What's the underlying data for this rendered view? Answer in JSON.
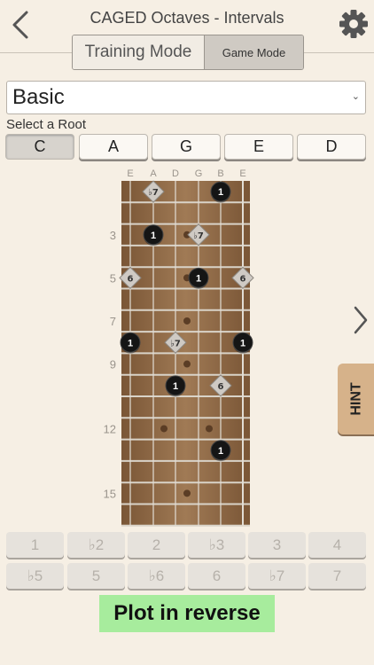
{
  "header": {
    "title": "CAGED Octaves - Intervals"
  },
  "mode_tabs": [
    {
      "label": "Training Mode",
      "selected": true
    },
    {
      "label": "Game Mode",
      "selected": false
    }
  ],
  "dropdown": {
    "value": "Basic"
  },
  "root_label": "Select a Root",
  "roots": [
    {
      "label": "C",
      "selected": true
    },
    {
      "label": "A",
      "selected": false
    },
    {
      "label": "G",
      "selected": false
    },
    {
      "label": "E",
      "selected": false
    },
    {
      "label": "D",
      "selected": false
    }
  ],
  "fretboard": {
    "strings": [
      "E",
      "A",
      "D",
      "G",
      "B",
      "E"
    ],
    "fret_labels": [
      {
        "fret": 3,
        "label": "3"
      },
      {
        "fret": 5,
        "label": "5"
      },
      {
        "fret": 7,
        "label": "7"
      },
      {
        "fret": 9,
        "label": "9"
      },
      {
        "fret": 12,
        "label": "12"
      },
      {
        "fret": 15,
        "label": "15"
      }
    ],
    "markers": [
      {
        "string": 2,
        "fret": 1,
        "shape": "diamond",
        "label": "♭7"
      },
      {
        "string": 5,
        "fret": 1,
        "shape": "circle",
        "label": "1"
      },
      {
        "string": 2,
        "fret": 3,
        "shape": "circle",
        "label": "1"
      },
      {
        "string": 4,
        "fret": 3,
        "shape": "diamond",
        "label": "♭7"
      },
      {
        "string": 1,
        "fret": 5,
        "shape": "diamond",
        "label": "6"
      },
      {
        "string": 4,
        "fret": 5,
        "shape": "circle",
        "label": "1"
      },
      {
        "string": 6,
        "fret": 5,
        "shape": "diamond",
        "label": "6"
      },
      {
        "string": 1,
        "fret": 8,
        "shape": "circle",
        "label": "1"
      },
      {
        "string": 3,
        "fret": 8,
        "shape": "diamond",
        "label": "♭7"
      },
      {
        "string": 6,
        "fret": 8,
        "shape": "circle",
        "label": "1"
      },
      {
        "string": 3,
        "fret": 10,
        "shape": "circle",
        "label": "1"
      },
      {
        "string": 5,
        "fret": 10,
        "shape": "diamond",
        "label": "6"
      },
      {
        "string": 5,
        "fret": 13,
        "shape": "circle",
        "label": "1"
      }
    ]
  },
  "hint_label": "HINT",
  "interval_keys": [
    [
      "1",
      "♭2",
      "2",
      "♭3",
      "3",
      "4"
    ],
    [
      "♭5",
      "5",
      "♭6",
      "6",
      "♭7",
      "7"
    ]
  ],
  "reverse_label": "Plot in reverse"
}
